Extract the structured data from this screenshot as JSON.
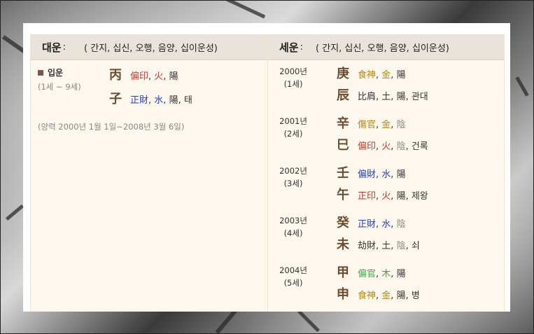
{
  "daewoon": {
    "title": "대운",
    "colon": ":",
    "subtitle": "( 간지,   십신, 오행, 음양, 십이운성)",
    "ipun_label": "입운",
    "ipun_age": "(1세 ~ 9세)",
    "stem": {
      "hanja": "丙",
      "sipsin": "偏印",
      "ohaeng": "火",
      "eumyang": "陽"
    },
    "branch": {
      "hanja": "子",
      "sipsin": "正財",
      "ohaeng": "水",
      "eumyang": "陽",
      "unseong": "태"
    },
    "period": "(양력 2000년 1월 1일~2008년 3월 6일)"
  },
  "sewoon": {
    "title": "세운",
    "colon": ":",
    "subtitle": "( 간지,   십신, 오행, 음양, 십이운성)",
    "years": [
      {
        "year": "2000년",
        "age": "(1세)",
        "stem": {
          "hanja": "庚",
          "sipsin": "食神",
          "ohaeng": "金",
          "eumyang": "陽"
        },
        "branch": {
          "hanja": "辰",
          "sipsin": "比肩",
          "ohaeng": "土",
          "eumyang": "陽",
          "unseong": "관대"
        }
      },
      {
        "year": "2001년",
        "age": "(2세)",
        "stem": {
          "hanja": "辛",
          "sipsin": "傷官",
          "ohaeng": "金",
          "eumyang": "陰"
        },
        "branch": {
          "hanja": "巳",
          "sipsin": "偏印",
          "ohaeng": "火",
          "eumyang": "陰",
          "unseong": "건록"
        }
      },
      {
        "year": "2002년",
        "age": "(3세)",
        "stem": {
          "hanja": "壬",
          "sipsin": "偏財",
          "ohaeng": "水",
          "eumyang": "陽"
        },
        "branch": {
          "hanja": "午",
          "sipsin": "正印",
          "ohaeng": "火",
          "eumyang": "陽",
          "unseong": "제왕"
        }
      },
      {
        "year": "2003년",
        "age": "(4세)",
        "stem": {
          "hanja": "癸",
          "sipsin": "正財",
          "ohaeng": "水",
          "eumyang": "陰"
        },
        "branch": {
          "hanja": "未",
          "sipsin": "劫財",
          "ohaeng": "土",
          "eumyang": "陰",
          "unseong": "쇠"
        }
      },
      {
        "year": "2004년",
        "age": "(5세)",
        "stem": {
          "hanja": "甲",
          "sipsin": "偏官",
          "ohaeng": "木",
          "eumyang": "陽"
        },
        "branch": {
          "hanja": "申",
          "sipsin": "食神",
          "ohaeng": "金",
          "eumyang": "陽",
          "unseong": "병"
        }
      }
    ]
  },
  "colors": {
    "fire": "#c0392b",
    "water": "#1f3fc4",
    "metal": "#b08a12",
    "wood": "#3caa3c",
    "earth": "#333333",
    "yin": "#8a8a8a",
    "yang": "#333333"
  }
}
